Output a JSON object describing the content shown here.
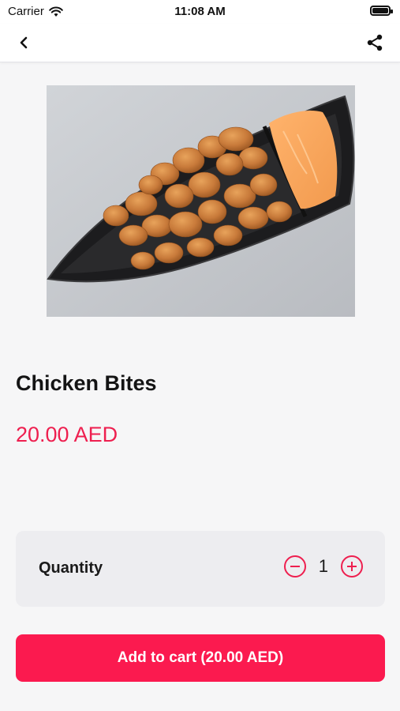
{
  "status_bar": {
    "carrier": "Carrier",
    "time": "11:08 AM"
  },
  "nav": {
    "back_icon": "chevron-left-icon",
    "share_icon": "share-icon"
  },
  "product": {
    "name": "Chicken Bites",
    "price": "20.00 AED"
  },
  "quantity": {
    "label": "Quantity",
    "value": "1"
  },
  "cart_button": {
    "label": "Add to cart (20.00 AED)"
  },
  "colors": {
    "accent": "#fb1a4f",
    "price": "#ee1f4f",
    "background": "#f6f6f7",
    "card": "#ededf0"
  }
}
